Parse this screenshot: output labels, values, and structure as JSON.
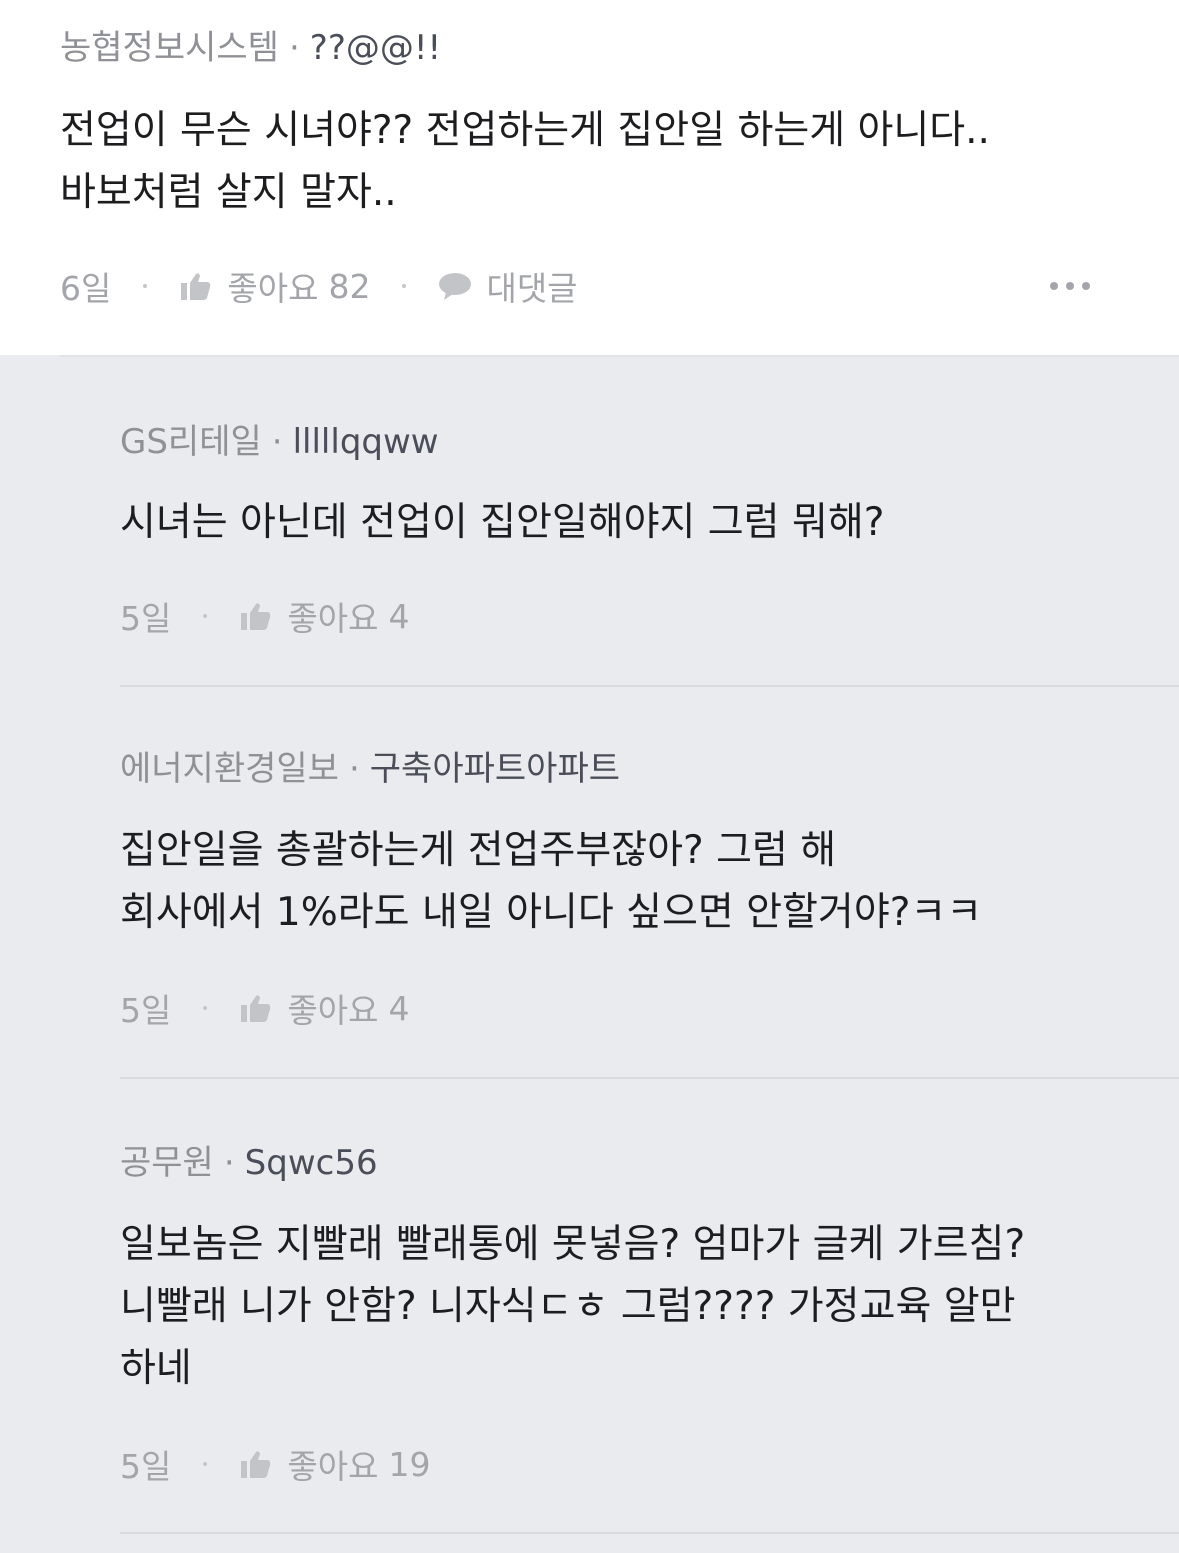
{
  "comments": [
    {
      "company": "농협정보시스템",
      "nickname": "??@@!!",
      "text": "전업이 무슨 시녀야??   전업하는게 집안일 하는게 아니다..\n바보처럼 살지 말자..",
      "time": "6일",
      "like_label": "좋아요",
      "like_count": "82",
      "reply_label": "대댓글"
    }
  ],
  "replies": [
    {
      "company": "GS리테일",
      "nickname": "lllllqqww",
      "text": "시녀는 아닌데 전업이 집안일해야지 그럼 뭐해?",
      "time": "5일",
      "like_label": "좋아요",
      "like_count": "4"
    },
    {
      "company": "에너지환경일보",
      "nickname": "구축아파트아파트",
      "text": "집안일을 총괄하는게 전업주부잖아? 그럼 해\n회사에서 1%라도 내일 아니다 싶으면 안할거야?ㅋㅋ",
      "time": "5일",
      "like_label": "좋아요",
      "like_count": "4"
    },
    {
      "company": "공무원",
      "nickname": "Sqwc56",
      "text": "일보놈은 지빨래 빨래통에 못넣음? 엄마가 글케 가르침?\n니빨래 니가 안함? 니자식ㄷㅎ 그럼???? 가정교육 알만\n하네",
      "time": "5일",
      "like_label": "좋아요",
      "like_count": "19"
    }
  ],
  "colors": {
    "main_bg": "#ffffff",
    "reply_bg": "#e9ebef",
    "company": "#8f9196",
    "nickname": "#4a4e59",
    "body": "#1d1d1f",
    "meta": "#a3a5aa"
  },
  "icons": {
    "like": "thumbs-up-icon",
    "reply": "speech-bubble-icon",
    "more": "more-horizontal-icon"
  }
}
